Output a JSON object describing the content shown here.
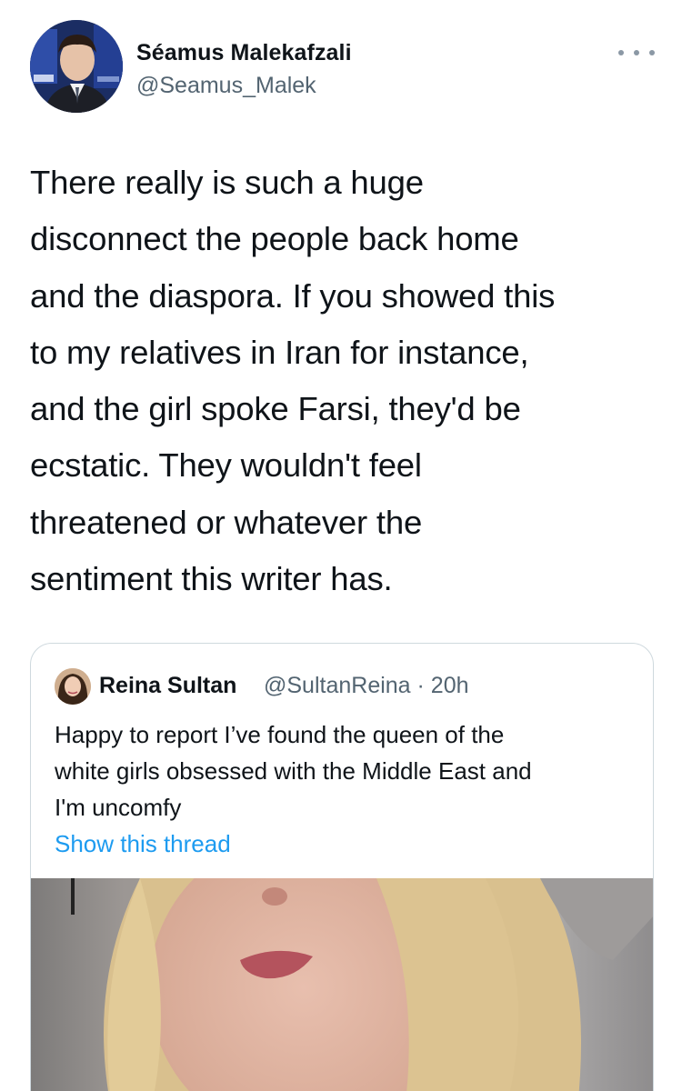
{
  "tweet": {
    "author_name": "Séamus Malekafzali",
    "author_handle": "@Seamus_Malek",
    "avatar_icon": "profile-photo-icon",
    "more_icon": "more-options-icon",
    "text": "There really is such a huge\ndisconnect the people back home\nand the diaspora. If you showed this\nto my relatives in Iran for instance,\nand the girl spoke Farsi, they'd be\necstatic. They wouldn't feel\nthreatened or whatever the\nsentiment this writer has."
  },
  "quoted_tweet": {
    "author_name": "Reina Sultan",
    "meta": "@SultanReina · 20h",
    "text": "Happy to report I’ve found the queen of the\nwhite girls obsessed with the Middle East and\nI'm uncomfy",
    "show_thread_label": "Show this thread",
    "media_icon": "video-thumbnail-icon"
  },
  "colors": {
    "text": "#0f1419",
    "secondary_text": "#536471",
    "link": "#1d9bf0",
    "border": "#cfd9de"
  }
}
